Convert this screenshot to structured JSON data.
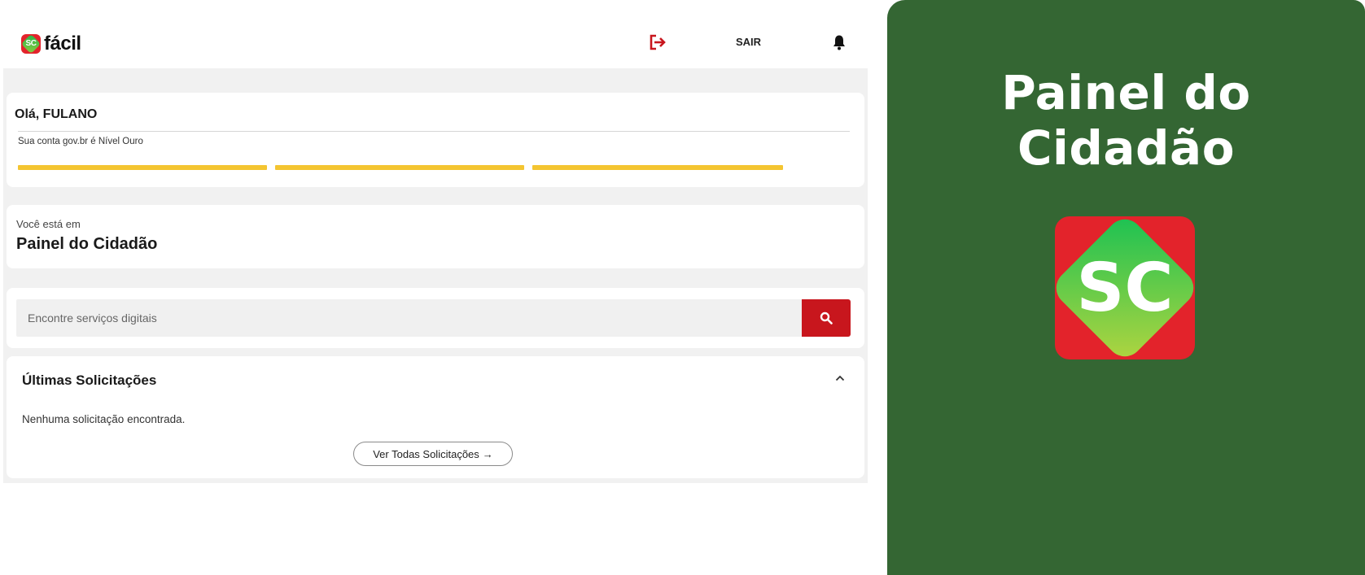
{
  "header": {
    "logo_badge": "SC",
    "logo_text": "fácil",
    "logout_label": "SAIR",
    "icons": [
      "logout-icon",
      "bell-icon"
    ]
  },
  "greeting": {
    "name": "Olá, FULANO",
    "level_text": "Sua conta gov.br é Nível Ouro",
    "level_bars": 3,
    "bar_color": "#f4c531"
  },
  "location": {
    "label": "Você está em",
    "title": "Painel do Cidadão"
  },
  "search": {
    "placeholder": "Encontre serviços digitais",
    "button_icon": "search-icon",
    "button_color": "#c8161d"
  },
  "requests": {
    "title": "Últimas Solicitações",
    "empty_text": "Nenhuma solicitação encontrada.",
    "view_all_label": "Ver Todas Solicitações",
    "view_all_arrow": "→",
    "collapse_icon": "chevron-up-icon"
  },
  "promo": {
    "title": "Painel do Cidadão",
    "logo_text": "SC",
    "background": "#346633"
  }
}
